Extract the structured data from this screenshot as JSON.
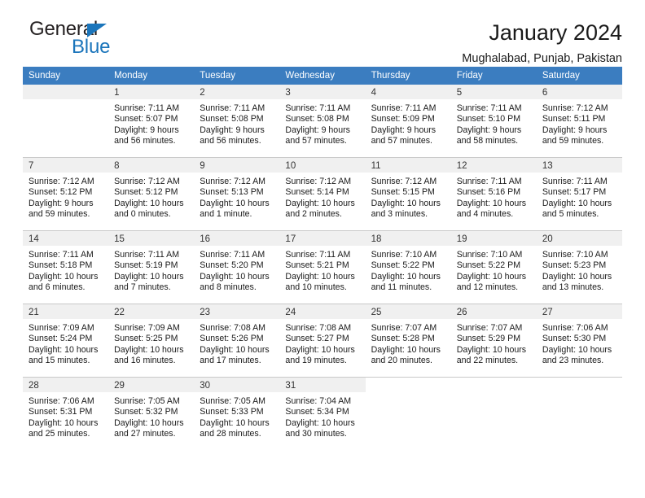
{
  "brand": {
    "word_one": "General",
    "word_two": "Blue",
    "triangle_color": "#1b75bb"
  },
  "header": {
    "title": "January 2024",
    "location": "Mughalabad, Punjab, Pakistan",
    "header_bg": "#3b7dc0",
    "daynum_bg": "#f0f0f0"
  },
  "weekday_headers": [
    "Sunday",
    "Monday",
    "Tuesday",
    "Wednesday",
    "Thursday",
    "Friday",
    "Saturday"
  ],
  "weeks": [
    [
      {
        "day": "",
        "sunrise": "",
        "sunset": "",
        "daylight1": "",
        "daylight2": ""
      },
      {
        "day": "1",
        "sunrise": "Sunrise: 7:11 AM",
        "sunset": "Sunset: 5:07 PM",
        "daylight1": "Daylight: 9 hours",
        "daylight2": "and 56 minutes."
      },
      {
        "day": "2",
        "sunrise": "Sunrise: 7:11 AM",
        "sunset": "Sunset: 5:08 PM",
        "daylight1": "Daylight: 9 hours",
        "daylight2": "and 56 minutes."
      },
      {
        "day": "3",
        "sunrise": "Sunrise: 7:11 AM",
        "sunset": "Sunset: 5:08 PM",
        "daylight1": "Daylight: 9 hours",
        "daylight2": "and 57 minutes."
      },
      {
        "day": "4",
        "sunrise": "Sunrise: 7:11 AM",
        "sunset": "Sunset: 5:09 PM",
        "daylight1": "Daylight: 9 hours",
        "daylight2": "and 57 minutes."
      },
      {
        "day": "5",
        "sunrise": "Sunrise: 7:11 AM",
        "sunset": "Sunset: 5:10 PM",
        "daylight1": "Daylight: 9 hours",
        "daylight2": "and 58 minutes."
      },
      {
        "day": "6",
        "sunrise": "Sunrise: 7:12 AM",
        "sunset": "Sunset: 5:11 PM",
        "daylight1": "Daylight: 9 hours",
        "daylight2": "and 59 minutes."
      }
    ],
    [
      {
        "day": "7",
        "sunrise": "Sunrise: 7:12 AM",
        "sunset": "Sunset: 5:12 PM",
        "daylight1": "Daylight: 9 hours",
        "daylight2": "and 59 minutes."
      },
      {
        "day": "8",
        "sunrise": "Sunrise: 7:12 AM",
        "sunset": "Sunset: 5:12 PM",
        "daylight1": "Daylight: 10 hours",
        "daylight2": "and 0 minutes."
      },
      {
        "day": "9",
        "sunrise": "Sunrise: 7:12 AM",
        "sunset": "Sunset: 5:13 PM",
        "daylight1": "Daylight: 10 hours",
        "daylight2": "and 1 minute."
      },
      {
        "day": "10",
        "sunrise": "Sunrise: 7:12 AM",
        "sunset": "Sunset: 5:14 PM",
        "daylight1": "Daylight: 10 hours",
        "daylight2": "and 2 minutes."
      },
      {
        "day": "11",
        "sunrise": "Sunrise: 7:12 AM",
        "sunset": "Sunset: 5:15 PM",
        "daylight1": "Daylight: 10 hours",
        "daylight2": "and 3 minutes."
      },
      {
        "day": "12",
        "sunrise": "Sunrise: 7:11 AM",
        "sunset": "Sunset: 5:16 PM",
        "daylight1": "Daylight: 10 hours",
        "daylight2": "and 4 minutes."
      },
      {
        "day": "13",
        "sunrise": "Sunrise: 7:11 AM",
        "sunset": "Sunset: 5:17 PM",
        "daylight1": "Daylight: 10 hours",
        "daylight2": "and 5 minutes."
      }
    ],
    [
      {
        "day": "14",
        "sunrise": "Sunrise: 7:11 AM",
        "sunset": "Sunset: 5:18 PM",
        "daylight1": "Daylight: 10 hours",
        "daylight2": "and 6 minutes."
      },
      {
        "day": "15",
        "sunrise": "Sunrise: 7:11 AM",
        "sunset": "Sunset: 5:19 PM",
        "daylight1": "Daylight: 10 hours",
        "daylight2": "and 7 minutes."
      },
      {
        "day": "16",
        "sunrise": "Sunrise: 7:11 AM",
        "sunset": "Sunset: 5:20 PM",
        "daylight1": "Daylight: 10 hours",
        "daylight2": "and 8 minutes."
      },
      {
        "day": "17",
        "sunrise": "Sunrise: 7:11 AM",
        "sunset": "Sunset: 5:21 PM",
        "daylight1": "Daylight: 10 hours",
        "daylight2": "and 10 minutes."
      },
      {
        "day": "18",
        "sunrise": "Sunrise: 7:10 AM",
        "sunset": "Sunset: 5:22 PM",
        "daylight1": "Daylight: 10 hours",
        "daylight2": "and 11 minutes."
      },
      {
        "day": "19",
        "sunrise": "Sunrise: 7:10 AM",
        "sunset": "Sunset: 5:22 PM",
        "daylight1": "Daylight: 10 hours",
        "daylight2": "and 12 minutes."
      },
      {
        "day": "20",
        "sunrise": "Sunrise: 7:10 AM",
        "sunset": "Sunset: 5:23 PM",
        "daylight1": "Daylight: 10 hours",
        "daylight2": "and 13 minutes."
      }
    ],
    [
      {
        "day": "21",
        "sunrise": "Sunrise: 7:09 AM",
        "sunset": "Sunset: 5:24 PM",
        "daylight1": "Daylight: 10 hours",
        "daylight2": "and 15 minutes."
      },
      {
        "day": "22",
        "sunrise": "Sunrise: 7:09 AM",
        "sunset": "Sunset: 5:25 PM",
        "daylight1": "Daylight: 10 hours",
        "daylight2": "and 16 minutes."
      },
      {
        "day": "23",
        "sunrise": "Sunrise: 7:08 AM",
        "sunset": "Sunset: 5:26 PM",
        "daylight1": "Daylight: 10 hours",
        "daylight2": "and 17 minutes."
      },
      {
        "day": "24",
        "sunrise": "Sunrise: 7:08 AM",
        "sunset": "Sunset: 5:27 PM",
        "daylight1": "Daylight: 10 hours",
        "daylight2": "and 19 minutes."
      },
      {
        "day": "25",
        "sunrise": "Sunrise: 7:07 AM",
        "sunset": "Sunset: 5:28 PM",
        "daylight1": "Daylight: 10 hours",
        "daylight2": "and 20 minutes."
      },
      {
        "day": "26",
        "sunrise": "Sunrise: 7:07 AM",
        "sunset": "Sunset: 5:29 PM",
        "daylight1": "Daylight: 10 hours",
        "daylight2": "and 22 minutes."
      },
      {
        "day": "27",
        "sunrise": "Sunrise: 7:06 AM",
        "sunset": "Sunset: 5:30 PM",
        "daylight1": "Daylight: 10 hours",
        "daylight2": "and 23 minutes."
      }
    ],
    [
      {
        "day": "28",
        "sunrise": "Sunrise: 7:06 AM",
        "sunset": "Sunset: 5:31 PM",
        "daylight1": "Daylight: 10 hours",
        "daylight2": "and 25 minutes."
      },
      {
        "day": "29",
        "sunrise": "Sunrise: 7:05 AM",
        "sunset": "Sunset: 5:32 PM",
        "daylight1": "Daylight: 10 hours",
        "daylight2": "and 27 minutes."
      },
      {
        "day": "30",
        "sunrise": "Sunrise: 7:05 AM",
        "sunset": "Sunset: 5:33 PM",
        "daylight1": "Daylight: 10 hours",
        "daylight2": "and 28 minutes."
      },
      {
        "day": "31",
        "sunrise": "Sunrise: 7:04 AM",
        "sunset": "Sunset: 5:34 PM",
        "daylight1": "Daylight: 10 hours",
        "daylight2": "and 30 minutes."
      },
      {
        "day": "",
        "sunrise": "",
        "sunset": "",
        "daylight1": "",
        "daylight2": ""
      },
      {
        "day": "",
        "sunrise": "",
        "sunset": "",
        "daylight1": "",
        "daylight2": ""
      },
      {
        "day": "",
        "sunrise": "",
        "sunset": "",
        "daylight1": "",
        "daylight2": ""
      }
    ]
  ]
}
